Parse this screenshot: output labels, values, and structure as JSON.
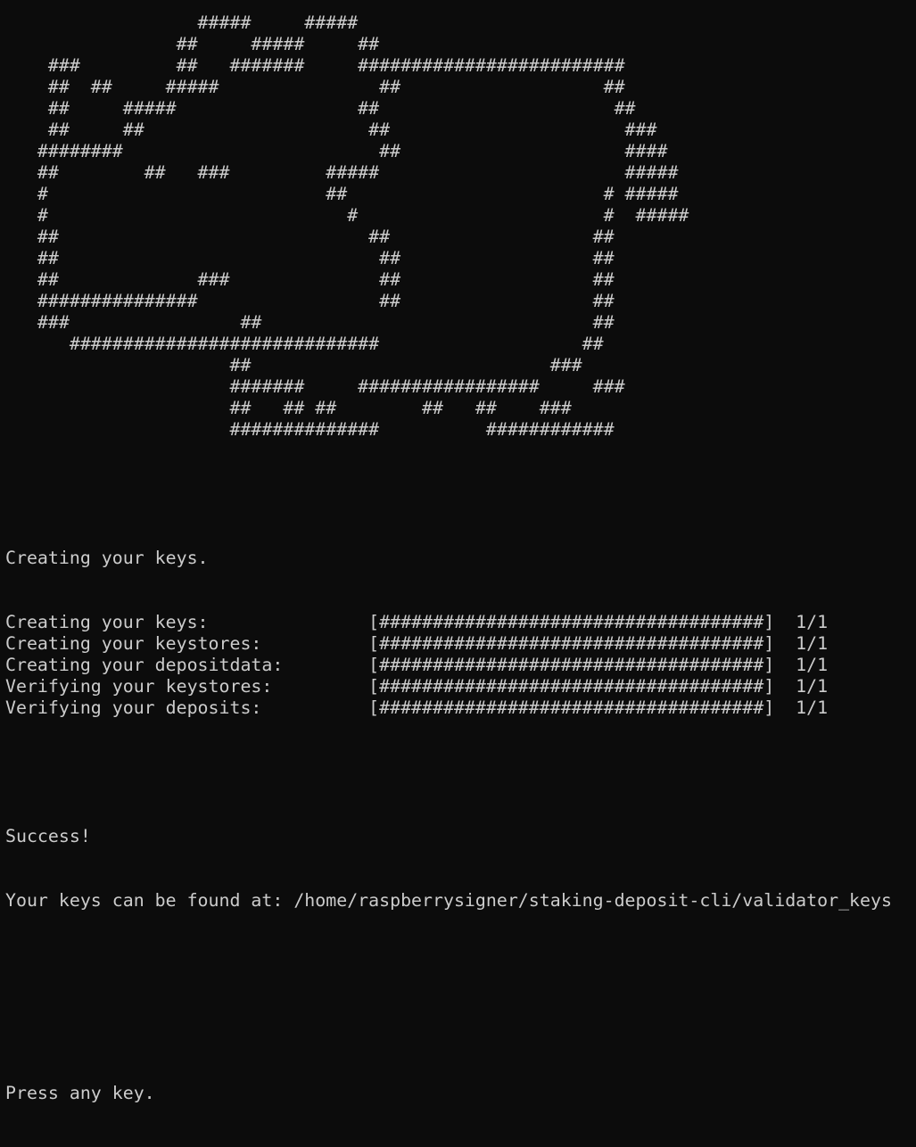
{
  "ascii_art": [
    "                  #####     #####",
    "                ##     #####     ##",
    "    ###         ##   #######     #########################",
    "    ##  ##     #####               ##                   ##",
    "    ##     #####                 ##                      ##",
    "    ##     ##                     ##                      ###",
    "   ########                        ##                     ####",
    "   ##        ##   ###         #####                       #####",
    "   #                          ##                        # #####",
    "   #                            #                       #  #####",
    "   ##                             ##                   ##",
    "   ##                              ##                  ##",
    "   ##             ###              ##                  ##",
    "   ###############                 ##                  ##",
    "   ###                ##                               ##",
    "      #############################                   ##",
    "                     ##                            ###",
    "                     #######     #################     ###",
    "                     ##   ## ##        ##   ##    ###",
    "                     ##############          ############"
  ],
  "output": {
    "creating_header": "Creating your keys.",
    "progress": [
      {
        "label": "Creating your keys:",
        "bar": "[####################################]",
        "count": "1/1"
      },
      {
        "label": "Creating your keystores:",
        "bar": "[####################################]",
        "count": "1/1"
      },
      {
        "label": "Creating your depositdata:",
        "bar": "[####################################]",
        "count": "1/1"
      },
      {
        "label": "Verifying your keystores:",
        "bar": "[####################################]",
        "count": "1/1"
      },
      {
        "label": "Verifying your deposits:",
        "bar": "[####################################]",
        "count": "1/1"
      }
    ],
    "success": "Success!",
    "keys_location": "Your keys can be found at: /home/raspberrysigner/staking-deposit-cli/validator_keys",
    "prompt": "Press any key."
  },
  "colors": {
    "background": "#0c0c0c",
    "foreground": "#cccccc"
  }
}
